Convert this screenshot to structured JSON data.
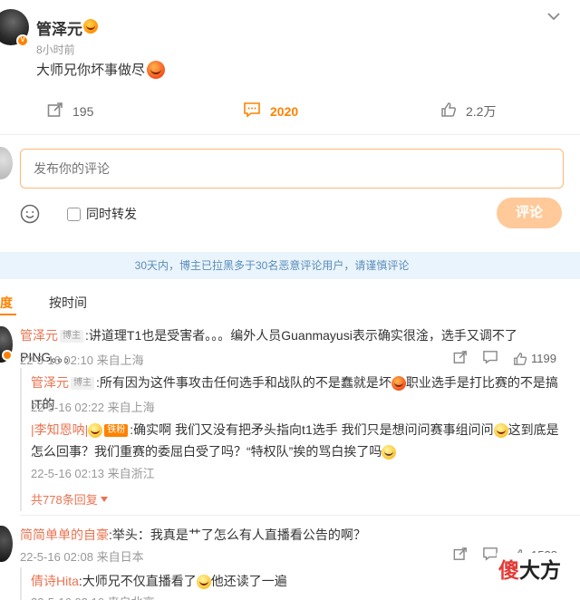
{
  "post": {
    "author": "管泽元",
    "time": "8小时前",
    "text": "大师兄你坏事做尽",
    "actions": {
      "share": "195",
      "comment": "2020",
      "like": "2.2万"
    }
  },
  "compose": {
    "placeholder": "发布你的评论",
    "repost_label": "同时转发",
    "submit_label": "评论"
  },
  "notice": "30天内，博主已拉黑多于30名恶意评论用户，请谨慎评论",
  "sort": {
    "hot": "热度",
    "time": "按时间"
  },
  "comments": [
    {
      "name": "管泽元",
      "tag": "博主",
      "text": "讲道理T1也是受害者。。。编外人员Guanmayusi表示确实很淦，选手又调不了PING。。。",
      "time": "22-5-16 02:10 来自上海",
      "likes": "1199",
      "replies": [
        {
          "name": "管泽元",
          "tag": "博主",
          "text_a": "所有因为这件事攻击任何选手和战队的不是蠢就是坏",
          "text_b": "职业选手是打比赛的不是搞IT的",
          "time": "22-5-16 02:22 来自上海"
        },
        {
          "name": "|李知恩呐|",
          "tag": "铁粉",
          "text_a": "确实啊 我们又没有把矛头指向t1选手 我们只是想问问赛事组问问",
          "text_b": "这到底是怎么回事？我们重赛的委屈白受了吗？“特权队”挨的骂白挨了吗",
          "time": "22-5-16 02:13 来自浙江"
        }
      ],
      "more_replies": "共778条回复"
    },
    {
      "name": "简简单单的自豪",
      "text": "举头：我真是艹了怎么有人直播看公告的啊？",
      "time": "22-5-16 02:08 来自日本",
      "likes": "1528",
      "replies": [
        {
          "name": "倩诗Hita",
          "text_a": "大师兄不仅直播看了",
          "text_b": "他还读了一遍",
          "time": "22-5-16 02:16 来自北京"
        }
      ]
    }
  ],
  "watermark": {
    "part1": "傻",
    "part2": "大方"
  },
  "colors": {
    "accent": "#ff8200",
    "name": "#eb7350",
    "notice_bg": "#eaf4fc",
    "notice_text": "#5b8db8"
  }
}
